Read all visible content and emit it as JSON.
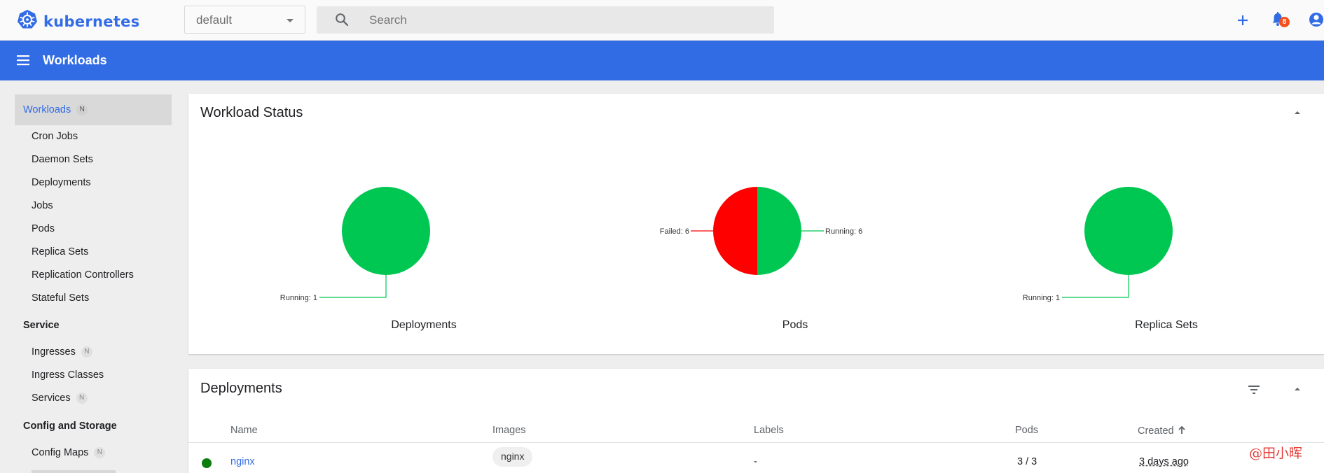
{
  "topbar": {
    "brand": "kubernetes",
    "namespace": "default",
    "search_placeholder": "Search",
    "notification_count": "8",
    "icons": [
      "kubernetes-logo-icon",
      "chevron-down-icon",
      "search-icon",
      "plus-icon",
      "bell-icon",
      "account-icon"
    ]
  },
  "appbar": {
    "title": "Workloads"
  },
  "sidebar": {
    "active": {
      "label": "Workloads",
      "badge": "N"
    },
    "workload_items": [
      "Cron Jobs",
      "Daemon Sets",
      "Deployments",
      "Jobs",
      "Pods",
      "Replica Sets",
      "Replication Controllers",
      "Stateful Sets"
    ],
    "service_heading": "Service",
    "service_items": [
      {
        "label": "Ingresses",
        "badge": "N"
      },
      {
        "label": "Ingress Classes"
      },
      {
        "label": "Services",
        "badge": "N"
      }
    ],
    "config_heading": "Config and Storage",
    "config_items": [
      {
        "label": "Config Maps",
        "badge": "N"
      }
    ]
  },
  "workload_status": {
    "title": "Workload Status",
    "charts": [
      {
        "name": "Deployments",
        "slices": [
          {
            "label": "Running: 1",
            "value": 1,
            "color": "#00c752"
          }
        ]
      },
      {
        "name": "Pods",
        "slices": [
          {
            "label": "Running: 6",
            "value": 6,
            "color": "#00c752"
          },
          {
            "label": "Failed: 6",
            "value": 6,
            "color": "#ff0000"
          }
        ]
      },
      {
        "name": "Replica Sets",
        "slices": [
          {
            "label": "Running: 1",
            "value": 1,
            "color": "#00c752"
          }
        ]
      }
    ]
  },
  "deployments": {
    "title": "Deployments",
    "columns": {
      "name": "Name",
      "images": "Images",
      "labels": "Labels",
      "pods": "Pods",
      "created": "Created"
    },
    "rows": [
      {
        "status_color": "#0b7d0b",
        "name": "nginx",
        "image": "nginx",
        "labels": "-",
        "pods": "3 / 3",
        "created": "3 days ago"
      }
    ]
  },
  "watermark": "@田小晖",
  "colors": {
    "brand": "#326ce5",
    "running": "#00c752",
    "failed": "#ff0000"
  }
}
